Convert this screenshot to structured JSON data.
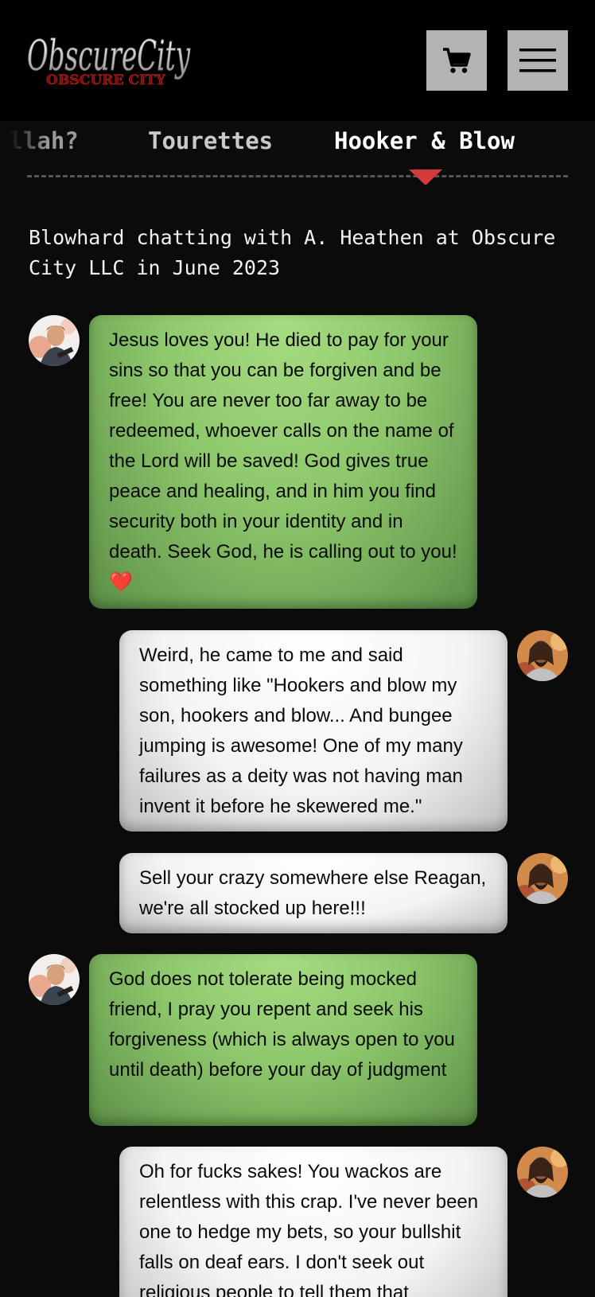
{
  "header": {
    "logo_text": "ObscureCity",
    "logo_subtext": "OBSCURE CITY",
    "cart_icon": "shopping-cart-icon",
    "menu_icon": "hamburger-menu-icon"
  },
  "tabs": [
    {
      "label": "Allah?"
    },
    {
      "label": "Tourettes"
    },
    {
      "label": "Hooker & Blow",
      "active": true
    }
  ],
  "subtitle": "Blowhard chatting with A. Heathen at Obscure City LLC in June 2023",
  "messages": [
    {
      "side": "left",
      "style": "green",
      "text": "Jesus loves you! He died to pay for your sins so that you can be forgiven and be free! You are never too far away to be redeemed, whoever calls on the name of the Lord will be saved! God gives true peace and healing, and in him you find security both in your identity and in death. Seek God, he is calling out to you!",
      "emoji": "❤️"
    },
    {
      "side": "right",
      "style": "white",
      "text": "Weird, he came to me and said something like \"Hookers and blow my son, hookers and blow... And bungee jumping is awesome! One of my many failures as a deity was not having man invent it before he skewered me.\""
    },
    {
      "side": "right",
      "style": "white",
      "text": "Sell your crazy somewhere else Reagan, we're all stocked up here!!!"
    },
    {
      "side": "left",
      "style": "green",
      "text": "God does not tolerate being mocked friend, I pray you repent and seek his forgiveness (which is always open to you until death) before your day of judgment"
    },
    {
      "side": "right",
      "style": "white",
      "text": "Oh for fucks sakes! You wackos are relentless with this crap. I've never been one to hedge my bets, so your bullshit falls on deaf ears. I don't seek out religious people to tell them that"
    }
  ],
  "colors": {
    "background": "#0b0b0b",
    "header": "#000000",
    "button": "#b3b3b3",
    "indicator": "#d23b3b",
    "green_bubble": "#8ec86c",
    "white_bubble": "#f4f4f4"
  }
}
